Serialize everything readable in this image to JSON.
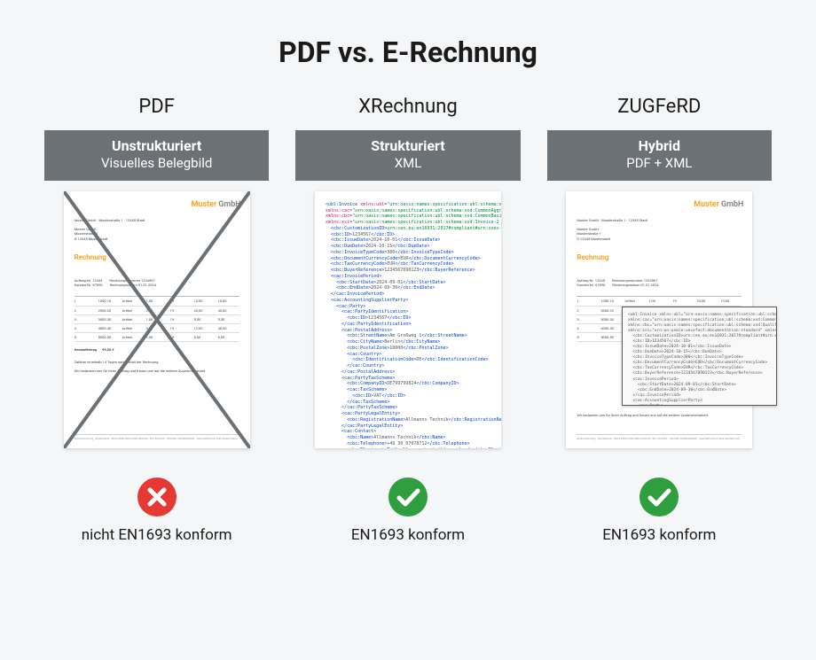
{
  "title": "PDF vs. E-Rechnung",
  "cols": {
    "pdf": {
      "head": "PDF",
      "badge1": "Unstrukturiert",
      "badge2": "Visuelles Belegbild",
      "status_label": "nicht EN1693 konform",
      "compliant": false
    },
    "xrechnung": {
      "head": "XRechnung",
      "badge1": "Strukturiert",
      "badge2": "XML",
      "status_label": "EN1693 konform",
      "compliant": true
    },
    "zugferd": {
      "head": "ZUGFeRD",
      "badge1": "Hybrid",
      "badge2": "PDF + XML",
      "status_label": "EN1693 konform",
      "compliant": true
    }
  },
  "doc_logo": {
    "part1": "Muster",
    "part2": "GmbH"
  },
  "doc_heading": "Rechnung"
}
